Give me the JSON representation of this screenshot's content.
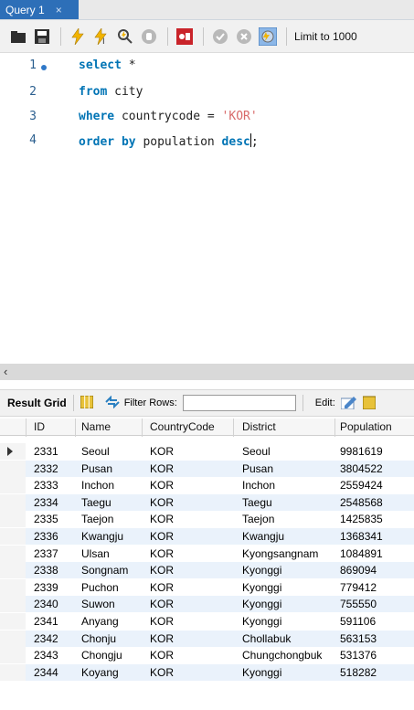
{
  "tab": {
    "title": "Query 1",
    "close": "×"
  },
  "toolbar": {
    "icons": [
      "open-folder-icon",
      "save-icon",
      "execute-icon",
      "execute-selection-icon",
      "explain-icon",
      "stop-icon",
      "toggle-continue-icon",
      "commit-icon",
      "rollback-icon",
      "autocommit-icon"
    ],
    "limit_label": "Limit to 1000"
  },
  "editor": {
    "lines": [
      {
        "num": "1",
        "parts": [
          {
            "t": "select",
            "k": "kw"
          },
          {
            "t": " *",
            "k": "op"
          }
        ]
      },
      {
        "num": "2",
        "parts": [
          {
            "t": "from",
            "k": "kw"
          },
          {
            "t": " city",
            "k": "id"
          }
        ]
      },
      {
        "num": "3",
        "parts": [
          {
            "t": "where",
            "k": "kw"
          },
          {
            "t": " countrycode = ",
            "k": "id"
          },
          {
            "t": "'KOR'",
            "k": "str"
          }
        ]
      },
      {
        "num": "4",
        "parts": [
          {
            "t": "order by",
            "k": "kw"
          },
          {
            "t": " population ",
            "k": "id"
          },
          {
            "t": "desc",
            "k": "kw"
          },
          {
            "t": ";",
            "k": "op"
          }
        ]
      }
    ]
  },
  "result": {
    "grid_label": "Result Grid",
    "filter_label": "Filter Rows:",
    "filter_value": "",
    "edit_label": "Edit:"
  },
  "grid": {
    "columns": [
      "ID",
      "Name",
      "CountryCode",
      "District",
      "Population"
    ],
    "rows": [
      [
        "2331",
        "Seoul",
        "KOR",
        "Seoul",
        "9981619"
      ],
      [
        "2332",
        "Pusan",
        "KOR",
        "Pusan",
        "3804522"
      ],
      [
        "2333",
        "Inchon",
        "KOR",
        "Inchon",
        "2559424"
      ],
      [
        "2334",
        "Taegu",
        "KOR",
        "Taegu",
        "2548568"
      ],
      [
        "2335",
        "Taejon",
        "KOR",
        "Taejon",
        "1425835"
      ],
      [
        "2336",
        "Kwangju",
        "KOR",
        "Kwangju",
        "1368341"
      ],
      [
        "2337",
        "Ulsan",
        "KOR",
        "Kyongsangnam",
        "1084891"
      ],
      [
        "2338",
        "Songnam",
        "KOR",
        "Kyonggi",
        "869094"
      ],
      [
        "2339",
        "Puchon",
        "KOR",
        "Kyonggi",
        "779412"
      ],
      [
        "2340",
        "Suwon",
        "KOR",
        "Kyonggi",
        "755550"
      ],
      [
        "2341",
        "Anyang",
        "KOR",
        "Kyonggi",
        "591106"
      ],
      [
        "2342",
        "Chonju",
        "KOR",
        "Chollabuk",
        "563153"
      ],
      [
        "2343",
        "Chongju",
        "KOR",
        "Chungchongbuk",
        "531376"
      ],
      [
        "2344",
        "Koyang",
        "KOR",
        "Kyonggi",
        "518282"
      ]
    ]
  }
}
